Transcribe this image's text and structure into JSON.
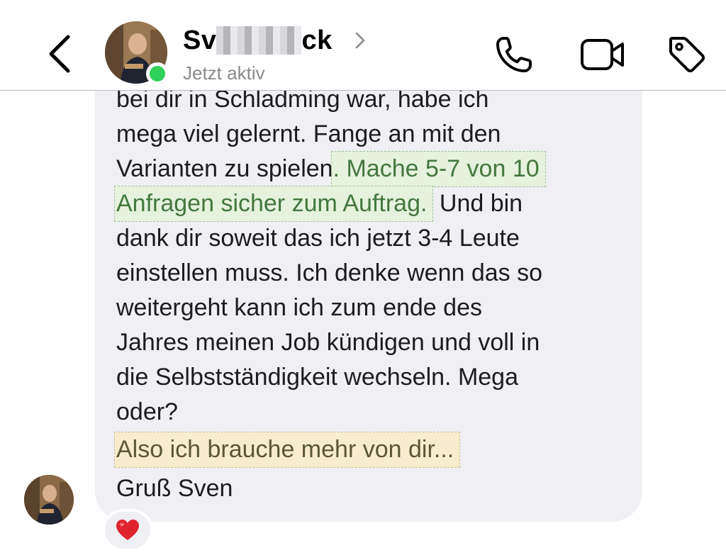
{
  "header": {
    "name_start": "Sv",
    "name_end": "ck",
    "status": "Jetzt aktiv"
  },
  "message": {
    "line1": "bei dir in Schladming war,  habe ich",
    "line2": "mega viel gelernt. Fange an mit den",
    "line3a": "Varianten zu spielen",
    "line3b": ". Mache 5-7 von 10",
    "line4a": "Anfragen sicher zum Auftrag.",
    "line4b": " Und bin",
    "line5": "dank dir soweit das ich jetzt 3-4 Leute",
    "line6": "einstellen muss. Ich denke wenn das so",
    "line7": "weitergeht kann ich zum ende des",
    "line8": "Jahres meinen Job kündigen und voll in",
    "line9": "die Selbstständigkeit wechseln. Mega",
    "line10": "oder?",
    "line11": "Also ich brauche mehr von dir...",
    "line12": "Gruß Sven"
  },
  "reaction": {
    "emoji": "heart"
  },
  "colors": {
    "bubble": "#efeff4",
    "highlight_green_bg": "#e6f2dd",
    "highlight_green_text": "#43783d",
    "highlight_yellow_bg": "#f7eccd",
    "online": "#2fd158"
  }
}
